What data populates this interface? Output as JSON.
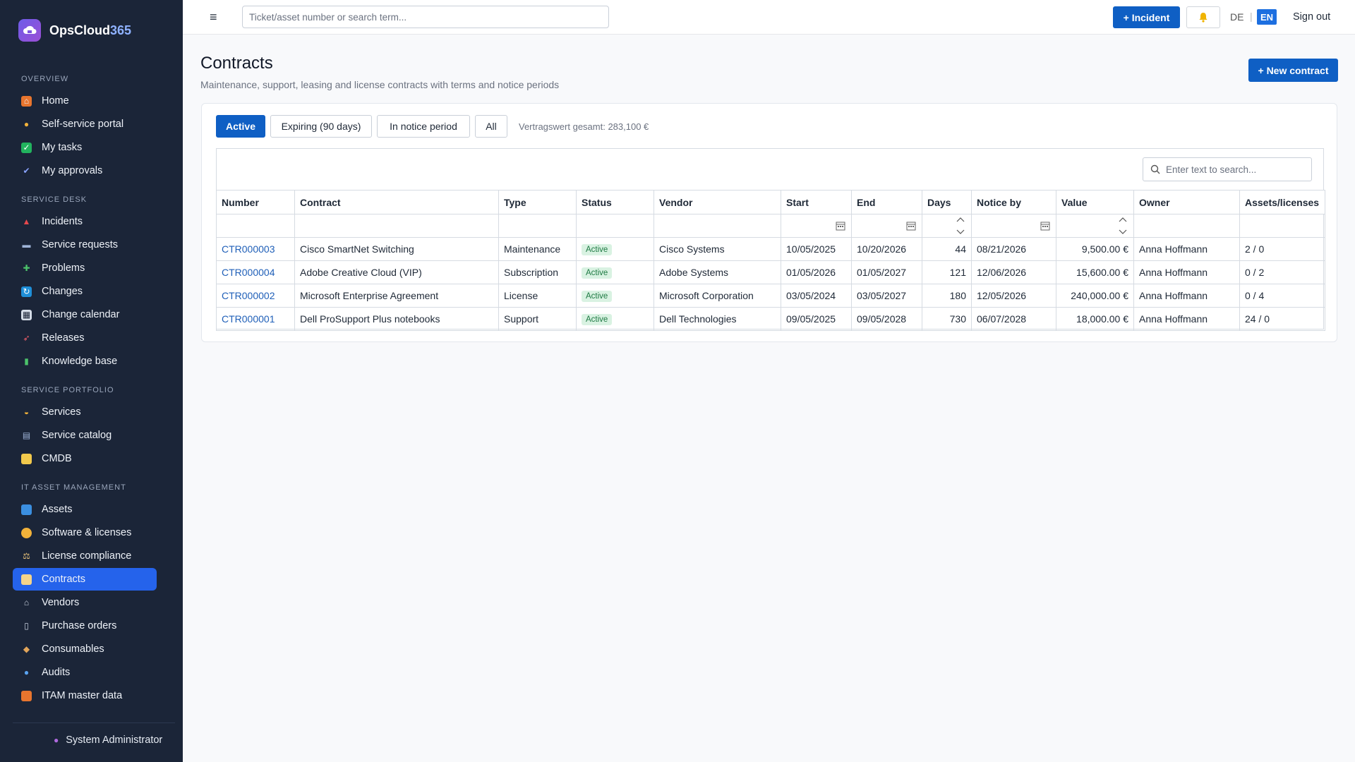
{
  "app": {
    "brand_main": "OpsCloud",
    "brand_accent": "365"
  },
  "sidebar": {
    "sections": [
      {
        "label": "OVERVIEW"
      },
      {
        "label": "SERVICE DESK"
      },
      {
        "label": "SERVICE PORTFOLIO"
      },
      {
        "label": "IT ASSET MANAGEMENT"
      }
    ],
    "items": [
      {
        "label": "Home",
        "icon": "home-icon"
      },
      {
        "label": "Self-service portal",
        "icon": "person-icon"
      },
      {
        "label": "My tasks",
        "icon": "checkbox-icon"
      },
      {
        "label": "My approvals",
        "icon": "checkmark-icon"
      },
      {
        "label": "Incidents",
        "icon": "siren-icon"
      },
      {
        "label": "Service requests",
        "icon": "inbox-icon"
      },
      {
        "label": "Problems",
        "icon": "puzzle-icon"
      },
      {
        "label": "Changes",
        "icon": "refresh-icon"
      },
      {
        "label": "Change calendar",
        "icon": "calendar-icon"
      },
      {
        "label": "Releases",
        "icon": "rocket-icon"
      },
      {
        "label": "Knowledge base",
        "icon": "books-icon"
      },
      {
        "label": "Services",
        "icon": "bell-service-icon"
      },
      {
        "label": "Service catalog",
        "icon": "catalog-icon"
      },
      {
        "label": "CMDB",
        "icon": "folder-icon"
      },
      {
        "label": "Assets",
        "icon": "laptop-icon"
      },
      {
        "label": "Software & licenses",
        "icon": "disc-icon"
      },
      {
        "label": "License compliance",
        "icon": "scales-icon"
      },
      {
        "label": "Contracts",
        "icon": "document-icon"
      },
      {
        "label": "Vendors",
        "icon": "vendor-icon"
      },
      {
        "label": "Purchase orders",
        "icon": "receipt-icon"
      },
      {
        "label": "Consumables",
        "icon": "package-icon"
      },
      {
        "label": "Audits",
        "icon": "magnifier-icon"
      },
      {
        "label": "ITAM master data",
        "icon": "grid-icon"
      }
    ],
    "active_item": "Contracts",
    "footer_user": "System Administrator"
  },
  "topbar": {
    "search_placeholder": "Ticket/asset number or search term...",
    "incident_button": "+ Incident",
    "lang_de": "DE",
    "lang_sep": "|",
    "lang_en": "EN",
    "sign_out": "Sign out"
  },
  "page": {
    "title": "Contracts",
    "subtitle": "Maintenance, support, leasing and license contracts with terms and notice periods",
    "new_button": "+ New contract"
  },
  "filters": {
    "tabs": [
      "Active",
      "Expiring (90 days)",
      "In notice period",
      "All"
    ],
    "selected": "Active",
    "total_value_text": "Vertragswert gesamt: 283,100 €"
  },
  "grid": {
    "search_placeholder": "Enter text to search...",
    "columns": [
      "Number",
      "Contract",
      "Type",
      "Status",
      "Vendor",
      "Start",
      "End",
      "Days",
      "Notice by",
      "Value",
      "Owner",
      "Assets/licenses"
    ],
    "rows": [
      {
        "number": "CTR000003",
        "contract": "Cisco SmartNet Switching",
        "type": "Maintenance",
        "status": "Active",
        "vendor": "Cisco Systems",
        "start": "10/05/2025",
        "end": "10/20/2026",
        "days": "44",
        "notice_by": "08/21/2026",
        "value": "9,500.00 €",
        "owner": "Anna Hoffmann",
        "assets": "2 / 0"
      },
      {
        "number": "CTR000004",
        "contract": "Adobe Creative Cloud (VIP)",
        "type": "Subscription",
        "status": "Active",
        "vendor": "Adobe Systems",
        "start": "01/05/2026",
        "end": "01/05/2027",
        "days": "121",
        "notice_by": "12/06/2026",
        "value": "15,600.00 €",
        "owner": "Anna Hoffmann",
        "assets": "0 / 2"
      },
      {
        "number": "CTR000002",
        "contract": "Microsoft Enterprise Agreement",
        "type": "License",
        "status": "Active",
        "vendor": "Microsoft Corporation",
        "start": "03/05/2024",
        "end": "03/05/2027",
        "days": "180",
        "notice_by": "12/05/2026",
        "value": "240,000.00 €",
        "owner": "Anna Hoffmann",
        "assets": "0 / 4"
      },
      {
        "number": "CTR000001",
        "contract": "Dell ProSupport Plus notebooks",
        "type": "Support",
        "status": "Active",
        "vendor": "Dell Technologies",
        "start": "09/05/2025",
        "end": "09/05/2028",
        "days": "730",
        "notice_by": "06/07/2028",
        "value": "18,000.00 €",
        "owner": "Anna Hoffmann",
        "assets": "24 / 0"
      }
    ]
  },
  "colors": {
    "sidebar_bg": "#1b2538",
    "primary": "#0f5fc4",
    "active_nav": "#2563eb",
    "status_active_bg": "#d9f2e2",
    "status_active_text": "#1e7a43"
  }
}
